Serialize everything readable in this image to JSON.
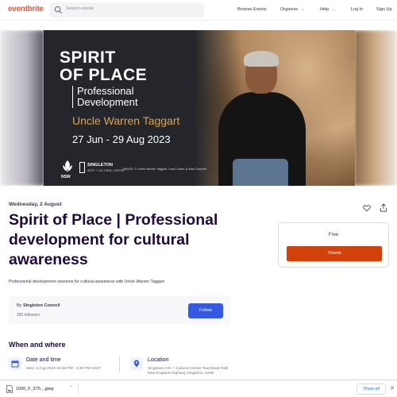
{
  "nav": {
    "logo": "eventbrite",
    "search_placeholder": "Search events",
    "browse": "Browse Events",
    "organise": "Organise",
    "help": "Help",
    "login": "Log In",
    "signup": "Sign Up"
  },
  "banner": {
    "title_line1": "SPIRIT",
    "title_line2": "OF PLACE",
    "subtitle_line1": "Professional",
    "subtitle_line2": "Development",
    "presenter": "Uncle Warren Taggart",
    "dates": "27 Jun  - 29 Aug 2023",
    "nsw": "NSW",
    "singleton": "SINGLETON",
    "singleton_sub": "ARTS + CULTURAL CENTRE",
    "credit": "IMAGE: © Uncle Warren Taggart, Carol Carter & Alan Chauvet"
  },
  "event": {
    "date": "Wednesday, 2 August",
    "title": "Spirit of Place | Professional development for cultural awareness",
    "summary": "Professional development sessions for cultural awareness with Uncle Warren Taggart",
    "organizer_prefix": "By",
    "organizer": "Singleton Council",
    "followers": "285 followers",
    "follow_label": "Follow"
  },
  "tickets": {
    "price": "Free",
    "button": "Tickets"
  },
  "when_where": {
    "heading": "When and where",
    "datetime_label": "Date and time",
    "datetime_value": "Wed, 2 Aug 2023 12:30 PM - 1:30 PM AEST",
    "location_label": "Location",
    "location_name": "Singleton Arts + Cultural Centre",
    "location_address": "Townhead Park New England Highway Singleton, NSW"
  },
  "download_bar": {
    "file_name": "1000_F_575....jpeg",
    "show_all": "Show all"
  },
  "colors": {
    "brand": "#f05537",
    "follow": "#3659e3",
    "tickets": "#d1410c",
    "heading": "#1e0a3c"
  }
}
